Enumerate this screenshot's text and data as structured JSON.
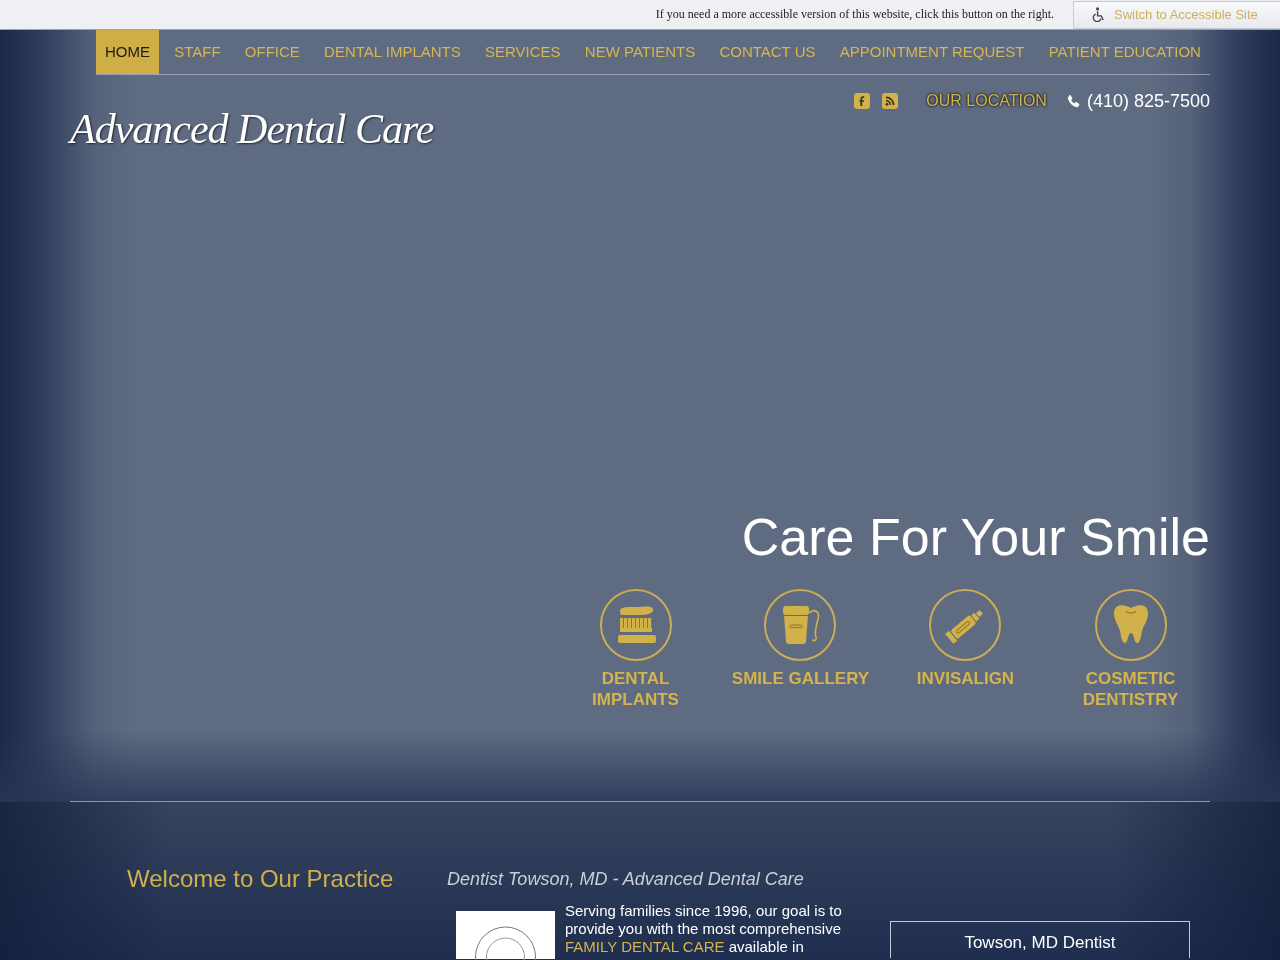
{
  "accessibility_bar": {
    "notice": "If you need a more accessible version of this website, click this button on the right.",
    "button": "Switch to Accessible Site"
  },
  "nav": {
    "items": [
      {
        "label": "HOME",
        "selected": true
      },
      {
        "label": "STAFF",
        "selected": false
      },
      {
        "label": "OFFICE",
        "selected": false
      },
      {
        "label": "DENTAL IMPLANTS",
        "selected": false
      },
      {
        "label": "SERVICES",
        "selected": false
      },
      {
        "label": "NEW PATIENTS",
        "selected": false
      },
      {
        "label": "CONTACT US",
        "selected": false
      },
      {
        "label": "APPOINTMENT REQUEST",
        "selected": false
      },
      {
        "label": "PATIENT EDUCATION",
        "selected": false
      }
    ]
  },
  "header": {
    "logo": "Advanced Dental Care",
    "location_link": "OUR LOCATION",
    "phone": "(410) 825-7500"
  },
  "hero": {
    "title": "Care For Your Smile",
    "services": [
      {
        "label": "DENTAL IMPLANTS"
      },
      {
        "label": "SMILE GALLERY"
      },
      {
        "label": "INVISALIGN"
      },
      {
        "label": "COSMETIC DENTISTRY"
      }
    ]
  },
  "welcome": {
    "heading": "Welcome to Our Practice",
    "subheading": "Dentist Towson, MD - Advanced Dental Care",
    "intro": {
      "text": "Serving families since 1996, our goal is to provide you with the most comprehensive",
      "link": "FAMILY DENTAL CARE",
      "text_after": "available in"
    },
    "side_box": {
      "title": "Towson, MD Dentist"
    }
  }
}
